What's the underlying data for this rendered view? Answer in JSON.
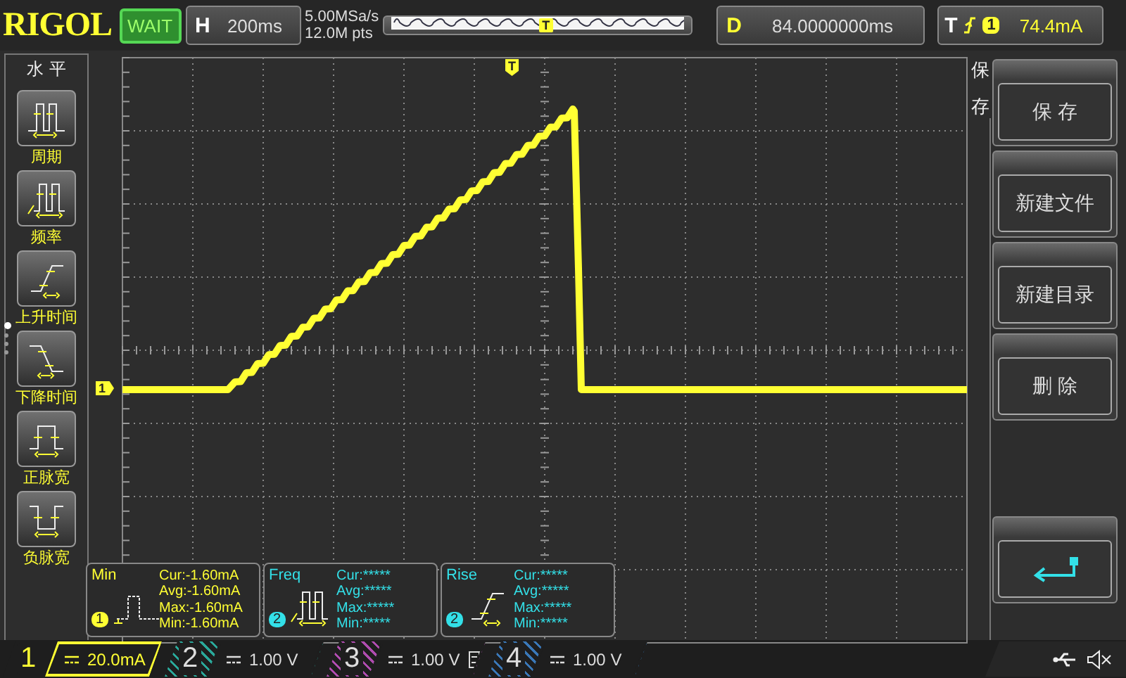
{
  "top_bar": {
    "brand": "RIGOL",
    "run_status": "WAIT",
    "horizontal": {
      "label": "H",
      "timebase": "200ms"
    },
    "sample_rate": "5.00MSa/s",
    "memory_depth": "12.0M pts",
    "timeline_marker": "T",
    "delay": {
      "label": "D",
      "value": "84.0000000ms"
    },
    "trigger": {
      "label": "T",
      "source": "1",
      "level": "74.4mA"
    }
  },
  "left_menu": {
    "title": "水 平",
    "items": [
      {
        "label": "周期",
        "kind": "period"
      },
      {
        "label": "频率",
        "kind": "frequency"
      },
      {
        "label": "上升时间",
        "kind": "rise"
      },
      {
        "label": "下降时间",
        "kind": "fall"
      },
      {
        "label": "正脉宽",
        "kind": "pos_width"
      },
      {
        "label": "负脉宽",
        "kind": "neg_width"
      }
    ],
    "pages": [
      {
        "selected": true
      },
      {
        "selected": false
      },
      {
        "selected": false
      },
      {
        "selected": false
      }
    ]
  },
  "display": {
    "channel_marker": "1",
    "trigger_marker": "T"
  },
  "measurements": [
    {
      "name": "Min",
      "channel": "1",
      "color": "#ffff33",
      "kind": "pulse",
      "rows": [
        "Cur:-1.60mA",
        "Avg:-1.60mA",
        "Max:-1.60mA",
        "Min:-1.60mA"
      ]
    },
    {
      "name": "Freq",
      "channel": "2",
      "color": "#33e0e8",
      "kind": "frequency",
      "rows": [
        "Cur:*****",
        "Avg:*****",
        "Max:*****",
        "Min:*****"
      ]
    },
    {
      "name": "Rise",
      "channel": "2",
      "color": "#33e0e8",
      "kind": "rise",
      "rows": [
        "Cur:*****",
        "Avg:*****",
        "Max:*****",
        "Min:*****"
      ]
    }
  ],
  "right_menu": {
    "title": "保存",
    "buttons": [
      {
        "kind": "text",
        "label": "保 存"
      },
      {
        "kind": "text",
        "label": "新建文件"
      },
      {
        "kind": "text",
        "label": "新建目录"
      },
      {
        "kind": "text",
        "label": "删 除"
      },
      {
        "kind": "spacer"
      },
      {
        "kind": "return"
      }
    ]
  },
  "channels": [
    {
      "number": "1",
      "scale": "20.0mA",
      "color": "#ffff33",
      "selected": true,
      "memory": false
    },
    {
      "number": "2",
      "scale": "1.00 V",
      "color": "#2aa89a",
      "selected": false,
      "memory": false
    },
    {
      "number": "3",
      "scale": "1.00 V",
      "color": "#b04cb0",
      "selected": false,
      "memory": true
    },
    {
      "number": "4",
      "scale": "1.00 V",
      "color": "#3a78b8",
      "selected": false,
      "memory": false
    }
  ]
}
